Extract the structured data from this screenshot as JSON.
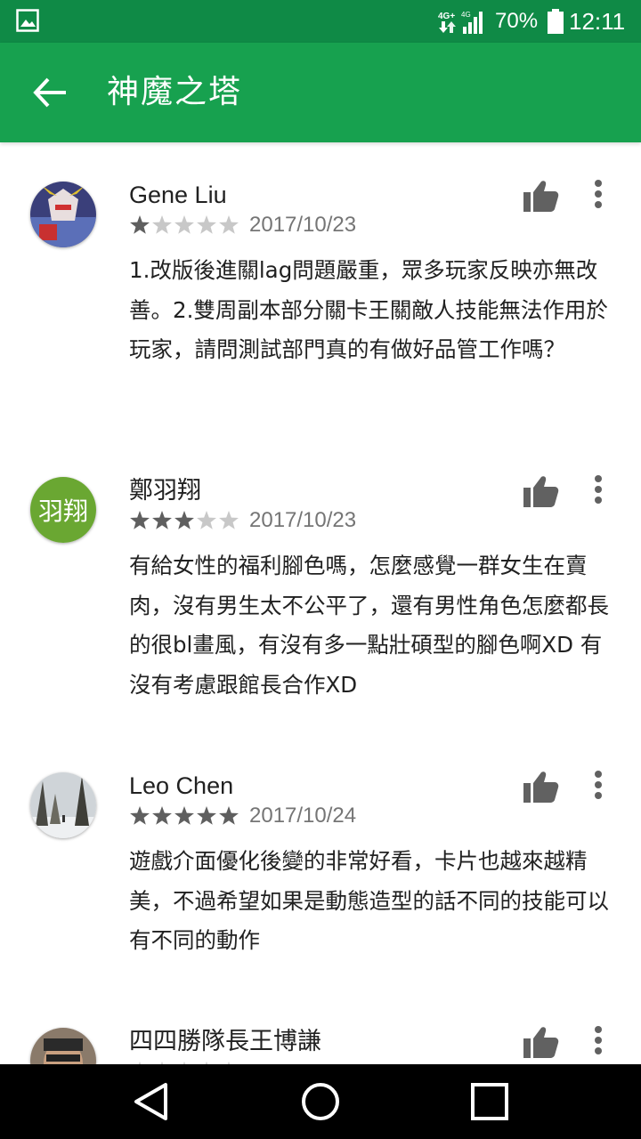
{
  "status_bar": {
    "network_badge": "4G+",
    "network_small": "4G",
    "battery_percent": "70%",
    "time": "12:11",
    "icons": [
      "gallery-icon",
      "signal-icon",
      "battery-icon"
    ]
  },
  "toolbar": {
    "title": "神魔之塔",
    "back_icon": "arrow-left-icon"
  },
  "colors": {
    "status_bar": "#0f8a46",
    "toolbar": "#17a14f",
    "star_filled": "#5f5f5f",
    "star_empty": "#c8c8c8",
    "avatar_green": "#6aa732"
  },
  "reviews": [
    {
      "author": "Gene Liu",
      "rating": 1,
      "max_rating": 5,
      "date": "2017/10/23",
      "text": "1.改版後進關lag問題嚴重，眾多玩家反映亦無改善。2.雙周副本部分關卡王關敵人技能無法作用於玩家，請問測試部門真的有做好品管工作嗎？",
      "avatar": "image"
    },
    {
      "author": "鄭羽翔",
      "rating": 3,
      "max_rating": 5,
      "date": "2017/10/23",
      "text": "有給女性的福利腳色嗎，怎麼感覺一群女生在賣肉，沒有男生太不公平了，還有男性角色怎麼都長的很bl畫風，有沒有多一點壯碩型的腳色啊XD 有沒有考慮跟館長合作XD",
      "avatar": "text",
      "avatar_text": "羽翔"
    },
    {
      "author": "Leo Chen",
      "rating": 5,
      "max_rating": 5,
      "date": "2017/10/24",
      "text": "遊戲介面優化後變的非常好看，卡片也越來越精美，不過希望如果是動態造型的話不同的技能可以有不同的動作",
      "avatar": "image"
    },
    {
      "author": "四四勝隊長王博謙",
      "rating": 0,
      "max_rating": 5,
      "date": "",
      "text": "",
      "avatar": "image"
    }
  ],
  "nav_bar": {
    "icons": [
      "back-triangle-icon",
      "home-circle-icon",
      "recents-square-icon"
    ]
  }
}
